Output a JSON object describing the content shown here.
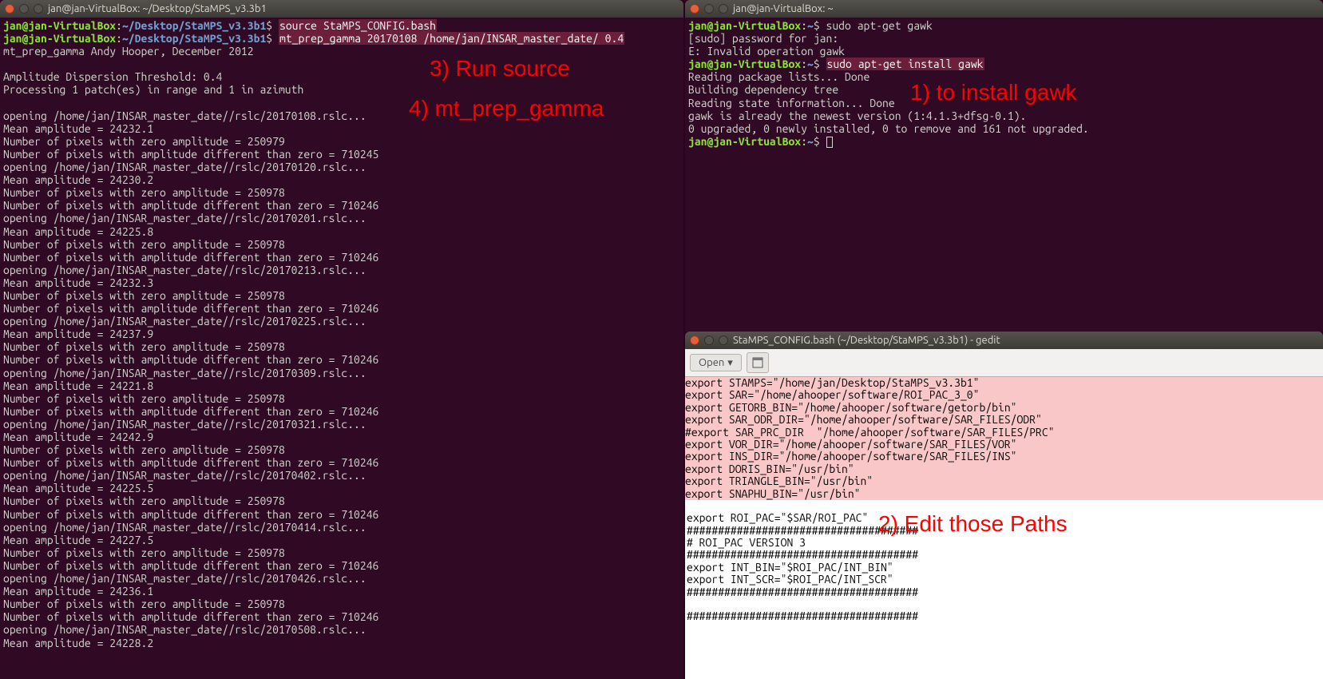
{
  "annotations": {
    "a1": "1) to install gawk",
    "a2": "2) Edit those Paths",
    "a3": "3) Run source",
    "a4": "4) mt_prep_gamma"
  },
  "term_left": {
    "title": "jan@jan-VirtualBox: ~/Desktop/StaMPS_v3.3b1",
    "prompt_user": "jan@jan-VirtualBox",
    "prompt_path": "~/Desktop/StaMPS_v3.3b1",
    "cmd1": "source StaMPS_CONFIG.bash",
    "cmd2": "mt_prep_gamma 20170108 /home/jan/INSAR_master_date/ 0.4",
    "out": "mt_prep_gamma Andy Hooper, December 2012\n\nAmplitude Dispersion Threshold: 0.4\nProcessing 1 patch(es) in range and 1 in azimuth\n\nopening /home/jan/INSAR_master_date//rslc/20170108.rslc...\nMean amplitude = 24232.1\nNumber of pixels with zero amplitude = 250979\nNumber of pixels with amplitude different than zero = 710245\nopening /home/jan/INSAR_master_date//rslc/20170120.rslc...\nMean amplitude = 24230.2\nNumber of pixels with zero amplitude = 250978\nNumber of pixels with amplitude different than zero = 710246\nopening /home/jan/INSAR_master_date//rslc/20170201.rslc...\nMean amplitude = 24225.8\nNumber of pixels with zero amplitude = 250978\nNumber of pixels with amplitude different than zero = 710246\nopening /home/jan/INSAR_master_date//rslc/20170213.rslc...\nMean amplitude = 24232.3\nNumber of pixels with zero amplitude = 250978\nNumber of pixels with amplitude different than zero = 710246\nopening /home/jan/INSAR_master_date//rslc/20170225.rslc...\nMean amplitude = 24237.9\nNumber of pixels with zero amplitude = 250978\nNumber of pixels with amplitude different than zero = 710246\nopening /home/jan/INSAR_master_date//rslc/20170309.rslc...\nMean amplitude = 24221.8\nNumber of pixels with zero amplitude = 250978\nNumber of pixels with amplitude different than zero = 710246\nopening /home/jan/INSAR_master_date//rslc/20170321.rslc...\nMean amplitude = 24242.9\nNumber of pixels with zero amplitude = 250978\nNumber of pixels with amplitude different than zero = 710246\nopening /home/jan/INSAR_master_date//rslc/20170402.rslc...\nMean amplitude = 24225.5\nNumber of pixels with zero amplitude = 250978\nNumber of pixels with amplitude different than zero = 710246\nopening /home/jan/INSAR_master_date//rslc/20170414.rslc...\nMean amplitude = 24227.5\nNumber of pixels with zero amplitude = 250978\nNumber of pixels with amplitude different than zero = 710246\nopening /home/jan/INSAR_master_date//rslc/20170426.rslc...\nMean amplitude = 24236.1\nNumber of pixels with zero amplitude = 250978\nNumber of pixels with amplitude different than zero = 710246\nopening /home/jan/INSAR_master_date//rslc/20170508.rslc...\nMean amplitude = 24228.2"
  },
  "term_right": {
    "title": "jan@jan-VirtualBox: ~",
    "prompt_user": "jan@jan-VirtualBox",
    "prompt_path": "~",
    "cmd1": "sudo apt-get gawk",
    "out1": "[sudo] password for jan: \nE: Invalid operation gawk",
    "cmd2": "sudo apt-get install gawk",
    "out2": "Reading package lists... Done\nBuilding dependency tree       \nReading state information... Done\ngawk is already the newest version (1:4.1.3+dfsg-0.1).\n0 upgraded, 0 newly installed, 0 to remove and 161 not upgraded."
  },
  "gedit": {
    "title": "StaMPS_CONFIG.bash (~/Desktop/StaMPS_v3.3b1) - gedit",
    "open_label": "Open",
    "hl_lines": "export STAMPS=\"/home/jan/Desktop/StaMPS_v3.3b1\"\nexport SAR=\"/home/ahooper/software/ROI_PAC_3_0\"\nexport GETORB_BIN=\"/home/ahooper/software/getorb/bin\"\nexport SAR_ODR_DIR=\"/home/ahooper/software/SAR_FILES/ODR\"\n#export SAR_PRC_DIR  \"/home/ahooper/software/SAR_FILES/PRC\"\nexport VOR_DIR=\"/home/ahooper/software/SAR_FILES/VOR\"\nexport INS_DIR=\"/home/ahooper/software/SAR_FILES/INS\"\nexport DORIS_BIN=\"/usr/bin\"\nexport TRIANGLE_BIN=\"/usr/bin\"\nexport SNAPHU_BIN=\"/usr/bin\"",
    "plain_lines": "\nexport ROI_PAC=\"$SAR/ROI_PAC\"\n#####################################\n# ROI_PAC VERSION 3\n#####################################\nexport INT_BIN=\"$ROI_PAC/INT_BIN\"\nexport INT_SCR=\"$ROI_PAC/INT_SCR\"\n#####################################\n\n#####################################"
  }
}
